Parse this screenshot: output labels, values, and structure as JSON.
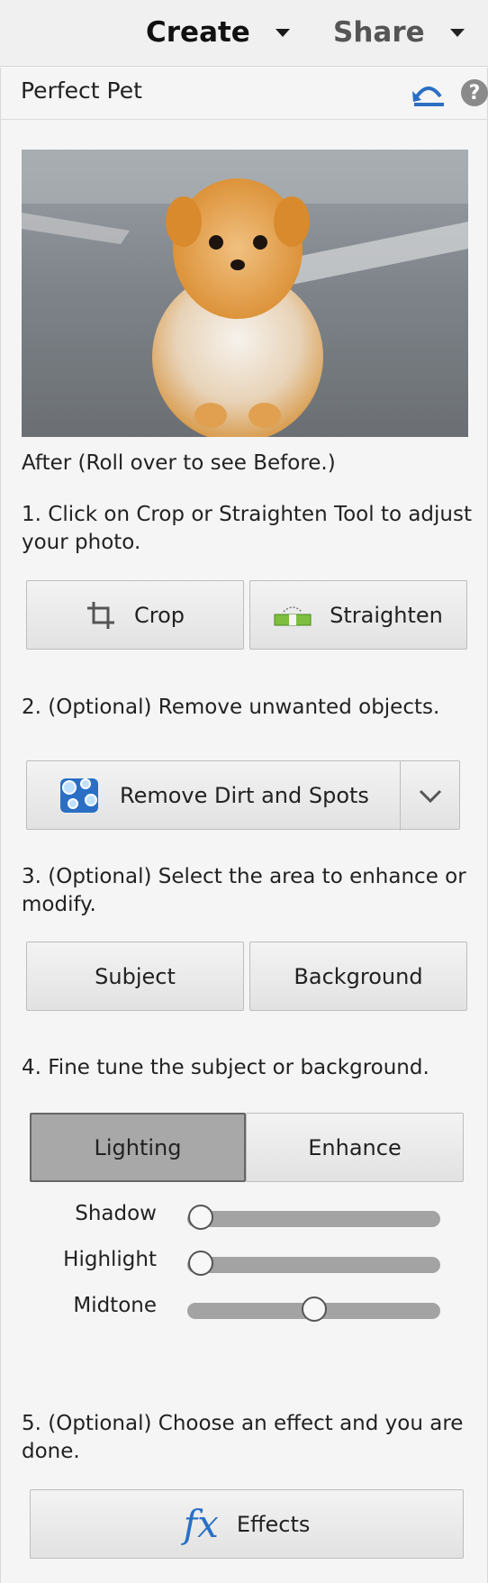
{
  "topbar": {
    "create_label": "Create",
    "share_label": "Share"
  },
  "panel": {
    "title": "Perfect Pet",
    "help_label": "?"
  },
  "photo": {
    "description_icon": "pomeranian-photo"
  },
  "hint": "After (Roll over to see Before.)",
  "steps": {
    "step1": "1. Click on Crop or Straighten Tool to adjust your photo.",
    "step2": "2. (Optional) Remove unwanted objects.",
    "step3": "3. (Optional) Select the area to enhance or modify.",
    "step4": "4. Fine tune the subject or background.",
    "step5": "5. (Optional) Choose an effect and you are done."
  },
  "buttons": {
    "crop": "Crop",
    "straighten": "Straighten",
    "remove": "Remove Dirt and Spots",
    "subject": "Subject",
    "background": "Background",
    "lighting": "Lighting",
    "enhance": "Enhance",
    "effects": "Effects"
  },
  "sliders": [
    {
      "label": "Shadow",
      "value": 0.0
    },
    {
      "label": "Highlight",
      "value": 0.0
    },
    {
      "label": "Midtone",
      "value": 0.5
    }
  ],
  "colors": {
    "accent_blue": "#2a6fc4",
    "selected_segment": "#a8a8a8"
  }
}
